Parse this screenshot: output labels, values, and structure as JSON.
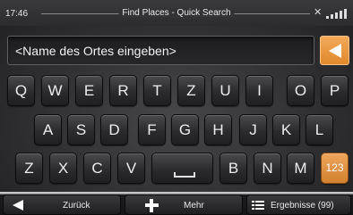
{
  "status_bar": {
    "time": "17:46",
    "title": "Find Places - Quick Search",
    "gps_icon": "satellite-icon",
    "signal_icon": "signal-bars-icon"
  },
  "search": {
    "placeholder": "<Name des Ortes eingeben>",
    "value": "",
    "backspace_icon": "backspace-arrow-icon"
  },
  "keyboard": {
    "row1": [
      "Q",
      "W",
      "E",
      "R",
      "T",
      "Z",
      "U",
      "I",
      "O",
      "P"
    ],
    "row2": [
      "A",
      "S",
      "D",
      "F",
      "G",
      "H",
      "J",
      "K",
      "L"
    ],
    "row3_left": [
      "Z",
      "X",
      "C",
      "V"
    ],
    "space_icon": "space-bar-icon",
    "row3_right": [
      "B",
      "N",
      "M"
    ],
    "mode_key": "123"
  },
  "bottom_bar": {
    "back_label": "Zurück",
    "more_label": "Mehr",
    "results_label": "Ergebnisse (99)"
  },
  "colors": {
    "accent": "#e8963e",
    "background": "#303032",
    "key": "#2b2b2d",
    "text": "#ececec"
  }
}
